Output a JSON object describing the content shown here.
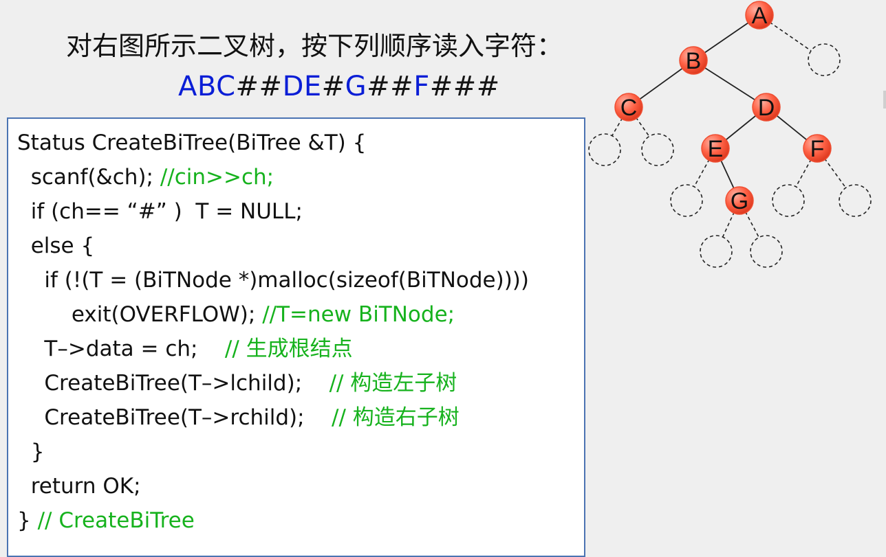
{
  "slide": {
    "prompt": "对右图所示二叉树，按下列顺序读入字符：",
    "sequence": {
      "blue_1": "ABC",
      "dark_1": "##",
      "blue_2": "DE",
      "dark_2": "#",
      "blue_3": "G",
      "dark_3": "##",
      "blue_4": "F",
      "dark_4": "###"
    },
    "colors": {
      "background": "#efefef",
      "blue": "#0a1ed6",
      "comment_green": "#16b21d",
      "node_fill": "#ff6246",
      "code_border": "#4a73b2"
    }
  },
  "code": {
    "lines": [
      {
        "text": "Status CreateBiTree(BiTree &T) {",
        "comment": ""
      },
      {
        "text": "  scanf(&ch); ",
        "comment": "//cin>>ch;"
      },
      {
        "text": "  if (ch== “#” )  T = NULL;",
        "comment": ""
      },
      {
        "text": "  else {",
        "comment": ""
      },
      {
        "text": "    if (!(T = (BiTNode *)malloc(sizeof(BiTNode))))",
        "comment": ""
      },
      {
        "text": "        exit(OVERFLOW); ",
        "comment": "//T=new BiTNode;"
      },
      {
        "text": "    T–>data = ch;    ",
        "comment": "// 生成根结点"
      },
      {
        "text": "    CreateBiTree(T–>lchild);    ",
        "comment": "// 构造左子树"
      },
      {
        "text": "    CreateBiTree(T–>rchild);    ",
        "comment": "// 构造右子树"
      },
      {
        "text": "  }",
        "comment": ""
      },
      {
        "text": "  return OK;",
        "comment": ""
      },
      {
        "text": "} ",
        "comment": "// CreateBiTree"
      }
    ]
  },
  "tree": {
    "nodes": [
      {
        "label": "A"
      },
      {
        "label": "B"
      },
      {
        "label": "C"
      },
      {
        "label": "D"
      },
      {
        "label": "E"
      },
      {
        "label": "F"
      },
      {
        "label": "G"
      }
    ]
  }
}
